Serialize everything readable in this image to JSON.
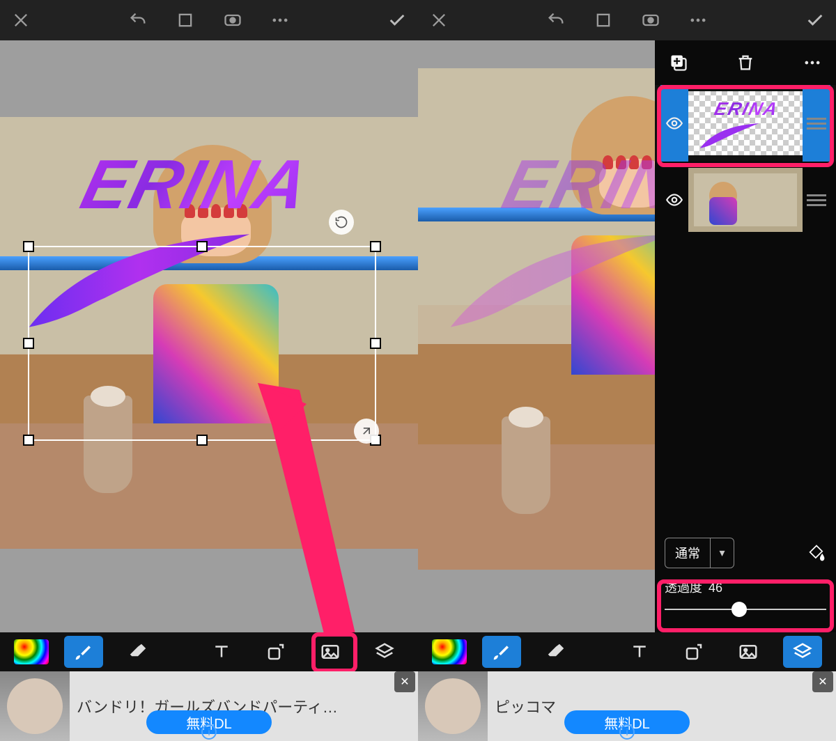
{
  "shared": {
    "logo_text": "ERINA",
    "ad_dl": "無料DL"
  },
  "screenA": {
    "ad_title": "バンドリ！ガールズバンドパーティ…"
  },
  "screenB": {
    "blend_mode": "通常",
    "opacity_label": "透過度",
    "opacity_value": "46",
    "opacity_percent": 46,
    "ad_title": "ピッコマ"
  }
}
